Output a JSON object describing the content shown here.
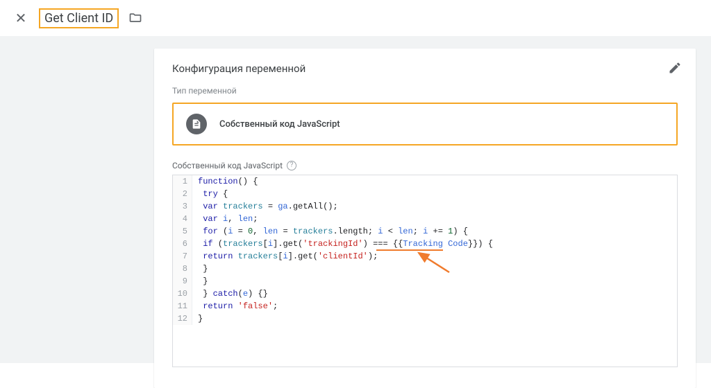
{
  "header": {
    "title": "Get Client ID"
  },
  "panel": {
    "title": "Конфигурация переменной",
    "type_label": "Тип переменной",
    "variable_type": "Собственный код JavaScript",
    "code_section_label": "Собственный код JavaScript"
  },
  "code_lines": [
    [
      [
        "kw",
        "function"
      ],
      [
        "br",
        "() {"
      ]
    ],
    [
      [
        "sp",
        " "
      ],
      [
        "kw",
        "try"
      ],
      [
        "br",
        " {"
      ]
    ],
    [
      [
        "sp",
        " "
      ],
      [
        "kw",
        "var"
      ],
      [
        "sp",
        " "
      ],
      [
        "var2",
        "trackers"
      ],
      [
        "op",
        " = "
      ],
      [
        "var",
        "ga"
      ],
      [
        "op",
        "."
      ],
      [
        "fn",
        "getAll"
      ],
      [
        "br",
        "();"
      ]
    ],
    [
      [
        "sp",
        " "
      ],
      [
        "kw",
        "var"
      ],
      [
        "sp",
        " "
      ],
      [
        "var",
        "i"
      ],
      [
        "op",
        ", "
      ],
      [
        "var",
        "len"
      ],
      [
        "op",
        ";"
      ]
    ],
    [
      [
        "sp",
        " "
      ],
      [
        "kw",
        "for"
      ],
      [
        "br",
        " ("
      ],
      [
        "var",
        "i"
      ],
      [
        "op",
        " = "
      ],
      [
        "num",
        "0"
      ],
      [
        "op",
        ", "
      ],
      [
        "var",
        "len"
      ],
      [
        "op",
        " = "
      ],
      [
        "var2",
        "trackers"
      ],
      [
        "op",
        "."
      ],
      [
        "prop",
        "length"
      ],
      [
        "op",
        "; "
      ],
      [
        "var",
        "i"
      ],
      [
        "op",
        " < "
      ],
      [
        "var",
        "len"
      ],
      [
        "op",
        "; "
      ],
      [
        "var",
        "i"
      ],
      [
        "op",
        " += "
      ],
      [
        "num",
        "1"
      ],
      [
        "br",
        ") {"
      ]
    ],
    [
      [
        "sp",
        " "
      ],
      [
        "kw",
        "if"
      ],
      [
        "br",
        " ("
      ],
      [
        "var2",
        "trackers"
      ],
      [
        "br",
        "["
      ],
      [
        "var",
        "i"
      ],
      [
        "br",
        "]."
      ],
      [
        "fn",
        "get"
      ],
      [
        "br",
        "("
      ],
      [
        "str",
        "'trackingId'"
      ],
      [
        "br",
        ") === {{"
      ],
      [
        "var",
        "Tracking Code"
      ],
      [
        "br",
        "}}) {"
      ]
    ],
    [
      [
        "sp",
        " "
      ],
      [
        "kw",
        "return"
      ],
      [
        "sp",
        " "
      ],
      [
        "var2",
        "trackers"
      ],
      [
        "br",
        "["
      ],
      [
        "var",
        "i"
      ],
      [
        "br",
        "]."
      ],
      [
        "fn",
        "get"
      ],
      [
        "br",
        "("
      ],
      [
        "str",
        "'clientId'"
      ],
      [
        "br",
        ");"
      ]
    ],
    [
      [
        "sp",
        " "
      ],
      [
        "br",
        "}"
      ]
    ],
    [
      [
        "sp",
        " "
      ],
      [
        "br",
        "}"
      ]
    ],
    [
      [
        "sp",
        " "
      ],
      [
        "br",
        "} "
      ],
      [
        "kw",
        "catch"
      ],
      [
        "br",
        "("
      ],
      [
        "var",
        "e"
      ],
      [
        "br",
        ") {}"
      ]
    ],
    [
      [
        "sp",
        " "
      ],
      [
        "kw",
        "return"
      ],
      [
        "sp",
        " "
      ],
      [
        "str",
        "'false'"
      ],
      [
        "op",
        ";"
      ]
    ],
    [
      [
        "br",
        "}"
      ]
    ]
  ]
}
